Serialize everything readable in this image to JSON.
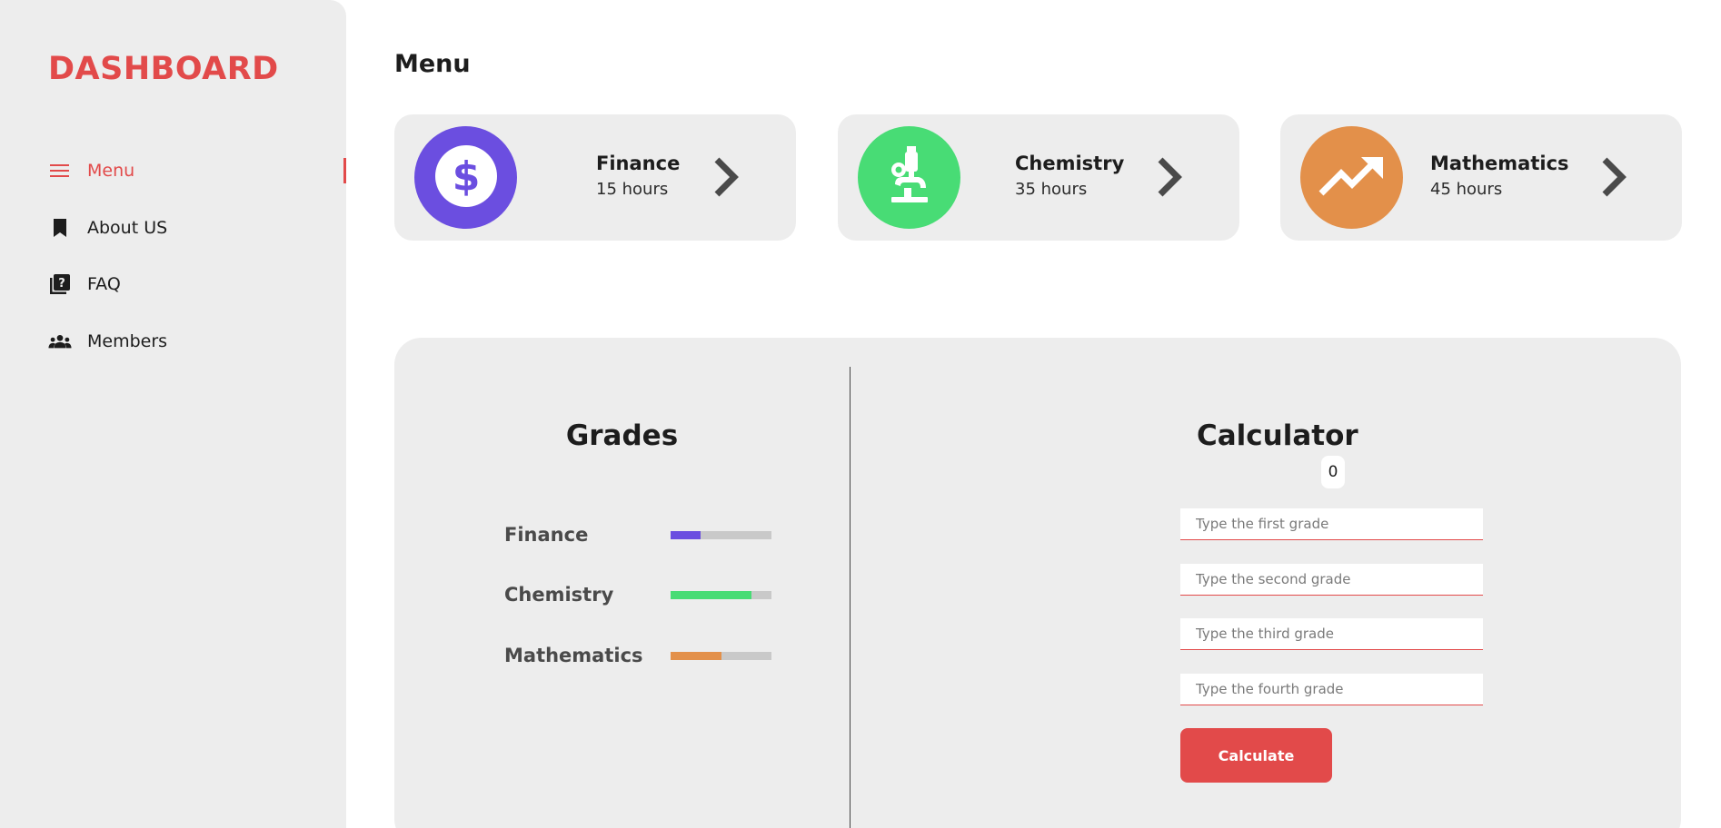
{
  "sidebar": {
    "brand": "DASHBOARD",
    "items": [
      {
        "label": "Menu",
        "icon": "menu-icon",
        "active": true
      },
      {
        "label": "About US",
        "icon": "bookmark-icon",
        "active": false
      },
      {
        "label": "FAQ",
        "icon": "faq-icon",
        "active": false
      },
      {
        "label": "Members",
        "icon": "members-icon",
        "active": false
      }
    ]
  },
  "main": {
    "title": "Menu",
    "cards": [
      {
        "name": "Finance",
        "hours": "15 hours",
        "icon": "dollar-icon",
        "color": "#6b4ee0"
      },
      {
        "name": "Chemistry",
        "hours": "35 hours",
        "icon": "microscope-icon",
        "color": "#48dc75"
      },
      {
        "name": "Mathematics",
        "hours": "45 hours",
        "icon": "trending-up-icon",
        "color": "#e3904a"
      }
    ]
  },
  "grades": {
    "title": "Grades",
    "items": [
      {
        "label": "Finance",
        "progress": 0.3,
        "color": "#6b4ee0"
      },
      {
        "label": "Chemistry",
        "progress": 0.8,
        "color": "#48dc75"
      },
      {
        "label": "Mathematics",
        "progress": 0.5,
        "color": "#e3904a"
      }
    ]
  },
  "calculator": {
    "title": "Calculator",
    "result": "0",
    "inputs": [
      {
        "placeholder": "Type the first grade"
      },
      {
        "placeholder": "Type the second grade"
      },
      {
        "placeholder": "Type the third grade"
      },
      {
        "placeholder": "Type the fourth grade"
      }
    ],
    "button_label": "Calculate"
  },
  "colors": {
    "accent": "#e24a4a",
    "panel": "#ededed"
  }
}
